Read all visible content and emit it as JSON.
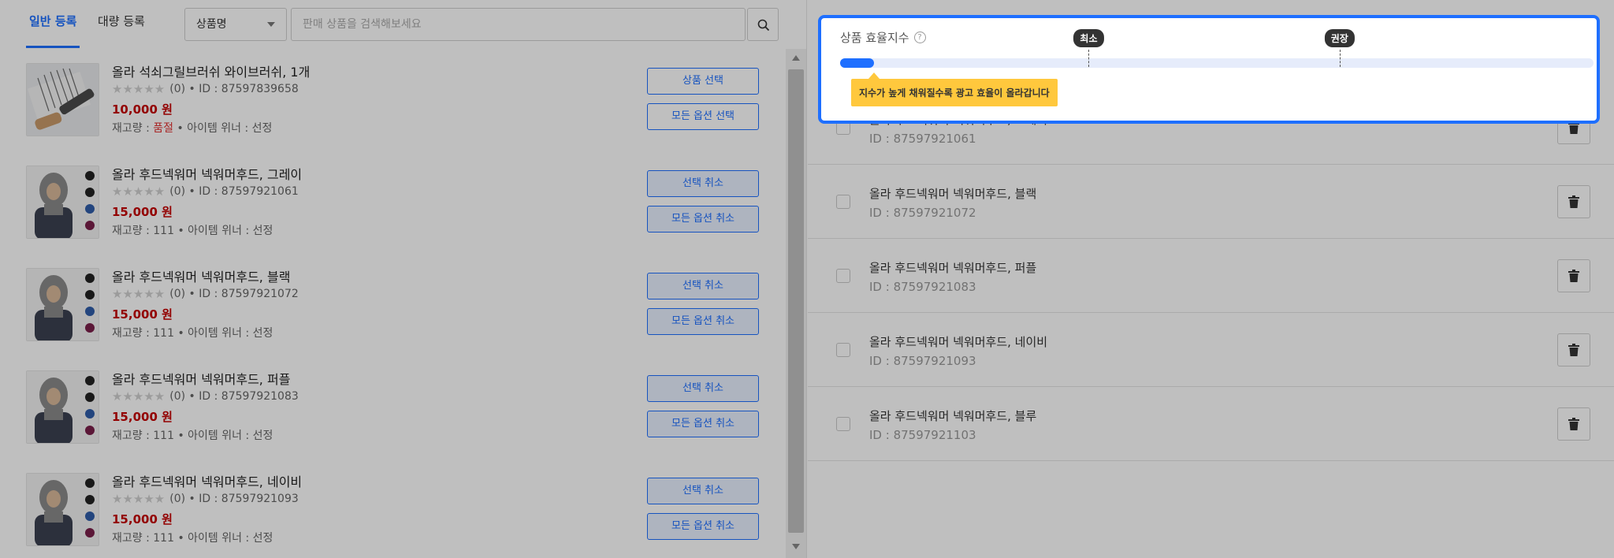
{
  "tabs": [
    {
      "label": "일반 등록"
    },
    {
      "label": "대량 등록"
    }
  ],
  "search": {
    "select_value": "상품명",
    "placeholder": "판매 상품을 검색해보세요"
  },
  "left_items": [
    {
      "name": "올라 석쇠그릴브러쉬 와이브러쉬, 1개",
      "rating_count": "(0)",
      "id_text": "• ID : 87597839658",
      "price": "10,000 원",
      "stock_label": "재고량 : ",
      "stock_value": "품절",
      "winner_text": " • 아이템 위너 : 선정",
      "btn1": "상품 선택",
      "btn2": "모든 옵션 선택"
    },
    {
      "name": "올라 후드넥워머 넥워머후드, 그레이",
      "rating_count": "(0)",
      "id_text": "• ID : 87597921061",
      "price": "15,000 원",
      "stock_label": "재고량 : ",
      "stock_value": "111",
      "winner_text": " • 아이템 위너 : 선정",
      "btn1": "선택 취소",
      "btn2": "모든 옵션 취소"
    },
    {
      "name": "올라 후드넥워머 넥워머후드, 블랙",
      "rating_count": "(0)",
      "id_text": "• ID : 87597921072",
      "price": "15,000 원",
      "stock_label": "재고량 : ",
      "stock_value": "111",
      "winner_text": " • 아이템 위너 : 선정",
      "btn1": "선택 취소",
      "btn2": "모든 옵션 취소"
    },
    {
      "name": "올라 후드넥워머 넥워머후드, 퍼플",
      "rating_count": "(0)",
      "id_text": "• ID : 87597921083",
      "price": "15,000 원",
      "stock_label": "재고량 : ",
      "stock_value": "111",
      "winner_text": " • 아이템 위너 : 선정",
      "btn1": "선택 취소",
      "btn2": "모든 옵션 취소"
    },
    {
      "name": "올라 후드넥워머 넥워머후드, 네이비",
      "rating_count": "(0)",
      "id_text": "• ID : 87597921093",
      "price": "15,000 원",
      "stock_label": "재고량 : ",
      "stock_value": "111",
      "winner_text": " • 아이템 위너 : 선정",
      "btn1": "선택 취소",
      "btn2": "모든 옵션 취소"
    }
  ],
  "efficiency": {
    "title": "상품 효율지수",
    "help": "?",
    "fill_fraction": 0.045,
    "min_label": "최소",
    "min_fraction": 0.33,
    "rec_label": "권장",
    "rec_fraction": 0.663,
    "tooltip": "지수가 높게 채워질수록 광고 효율이 올라갑니다"
  },
  "right_items": [
    {
      "name": "올라 후드넥워머 넥워머후드, 그레이",
      "id": "ID : 87597921061"
    },
    {
      "name": "올라 후드넥워머 넥워머후드, 블랙",
      "id": "ID : 87597921072"
    },
    {
      "name": "올라 후드넥워머 넥워머후드, 퍼플",
      "id": "ID : 87597921083"
    },
    {
      "name": "올라 후드넥워머 넥워머후드, 네이비",
      "id": "ID : 87597921093"
    },
    {
      "name": "올라 후드넥워머 넥워머후드, 블루",
      "id": "ID : 87597921103"
    }
  ],
  "colors": {
    "accent": "#1e6fff",
    "price": "#c40000",
    "tooltip": "#ffc83d"
  }
}
